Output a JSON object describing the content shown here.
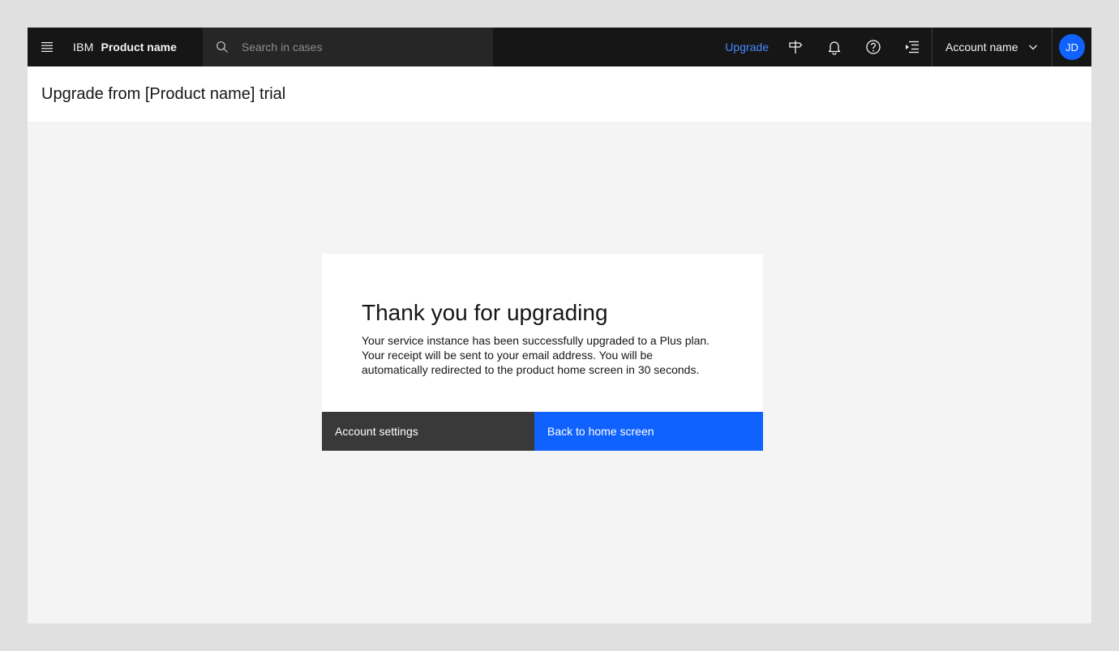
{
  "header": {
    "brand_prefix": "IBM",
    "brand_name": "Product name",
    "search": {
      "placeholder": "Search in cases",
      "value": ""
    },
    "upgrade_label": "Upgrade",
    "account_name": "Account name",
    "avatar_initials": "JD",
    "icons": [
      "menu-icon",
      "search-icon",
      "signpost-icon",
      "notification-icon",
      "help-icon",
      "activity-panel-icon",
      "chevron-down-icon"
    ]
  },
  "page": {
    "title": "Upgrade from [Product name] trial"
  },
  "modal": {
    "heading": "Thank you for upgrading",
    "body_line1": "Your service instance has been successfully upgraded to a Plus plan.",
    "body_line2": "Your receipt will be sent to your email address. You will be",
    "body_line3": "automatically redirected to the product home screen in 30 seconds.",
    "secondary_button": "Account settings",
    "primary_button": "Back to home screen"
  },
  "colors": {
    "header_bg": "#161616",
    "search_bg": "#262626",
    "link_blue": "#4589ff",
    "primary_blue": "#0f62fe",
    "secondary_btn": "#393939",
    "page_bg": "#f4f4f4",
    "outer_bg": "#e0e0e0"
  }
}
